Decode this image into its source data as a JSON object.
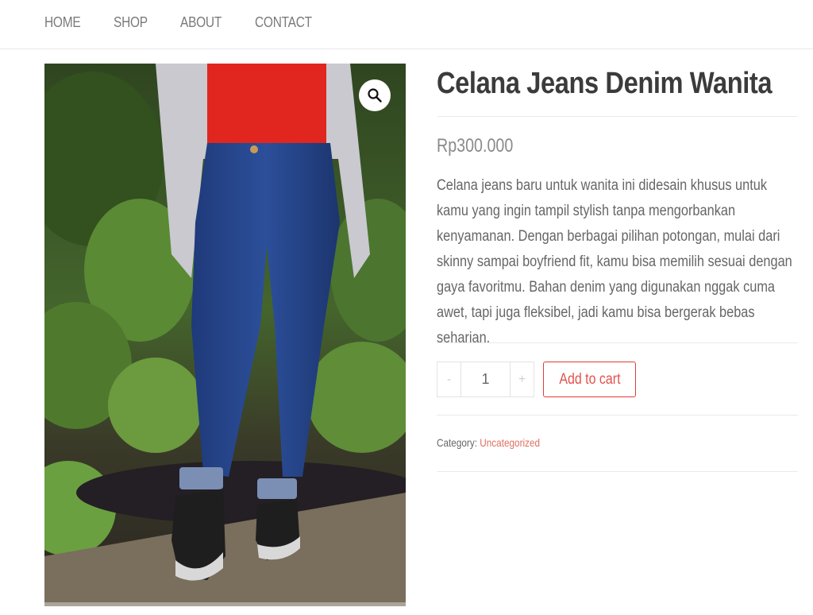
{
  "nav": {
    "items": [
      {
        "label": "HOME"
      },
      {
        "label": "SHOP"
      },
      {
        "label": "ABOUT"
      },
      {
        "label": "CONTACT"
      }
    ]
  },
  "product": {
    "image_alt": "Woman wearing dark blue skinny jeans, red top, grey cardigan and black sneakers",
    "zoom_icon": "magnifier-icon",
    "title": "Celana Jeans Denim Wanita",
    "price": "Rp300.000",
    "description": "Celana jeans baru untuk wanita ini didesain khusus untuk kamu yang ingin tampil stylish tanpa mengorbankan kenyamanan. Dengan berbagai pilihan potongan, mulai dari skinny sampai boyfriend fit, kamu bisa memilih sesuai dengan gaya favoritmu. Bahan denim yang digunakan nggak cuma awet, tapi juga fleksibel, jadi kamu bisa bergerak bebas seharian.",
    "quantity": {
      "minus_label": "-",
      "value": "1",
      "plus_label": "+"
    },
    "add_to_cart_label": "Add to cart",
    "category_label": "Category:",
    "category_value": "Uncategorized"
  },
  "colors": {
    "accent": "#e23b3b",
    "link": "#e07060",
    "title": "#3b3b3b",
    "text": "#666666",
    "divider": "#eaeaea"
  }
}
